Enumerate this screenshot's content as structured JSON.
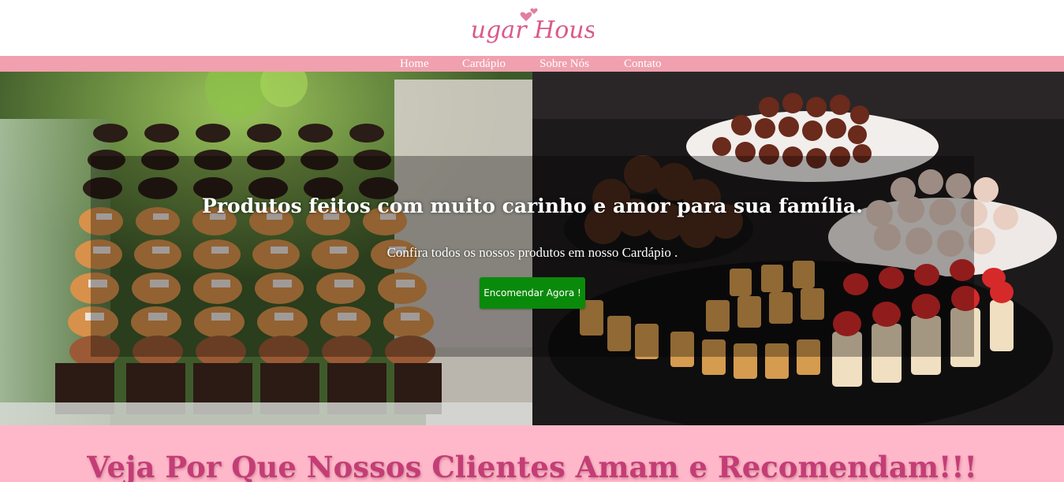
{
  "brand": {
    "name": "Sugar House",
    "logo_color": "#d95a8a"
  },
  "nav": {
    "items": [
      {
        "label": "Home"
      },
      {
        "label": "Cardápio"
      },
      {
        "label": "Sobre Nós"
      },
      {
        "label": "Contato"
      }
    ],
    "background": "#f0a0ae"
  },
  "hero": {
    "title": "Produtos feitos com muito carinho e amor para sua família.",
    "subtitle": "Confira todos os nossos produtos em nosso Cardápio .",
    "cta_label": "Encomendar Agora !",
    "cta_color": "#0a8a0a",
    "left_image": "brownie-cupcakes-photo",
    "right_image": "sweets-display-photo"
  },
  "testimonials": {
    "title": "Veja Por Que Nossos Clientes Amam e Recomendam!!!",
    "background": "#ffb8c9",
    "title_color": "#c43d76"
  }
}
